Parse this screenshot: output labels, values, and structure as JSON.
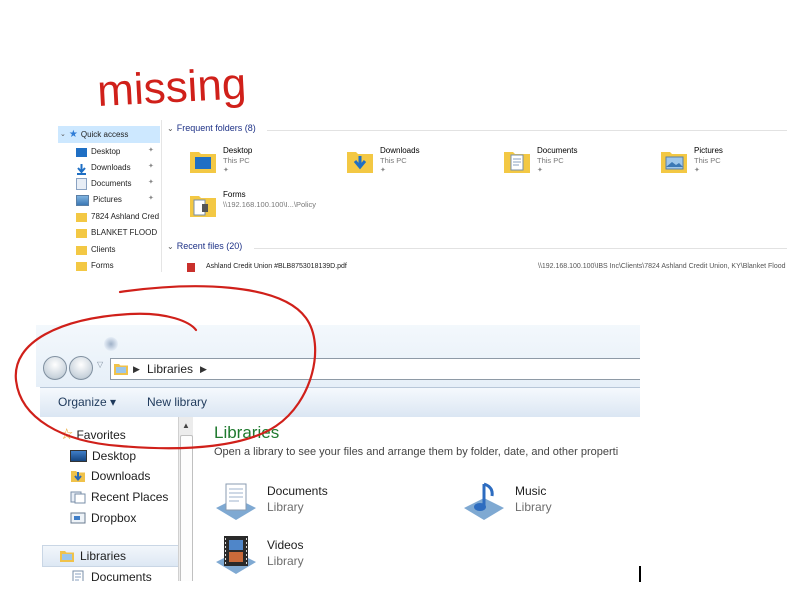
{
  "annotation": {
    "handwritten_text": "missing",
    "ink_color": "#d0201a"
  },
  "win10": {
    "nav": {
      "quick_access": "Quick access",
      "items": [
        {
          "label": "Desktop",
          "icon": "desktop-icon",
          "pinned": true
        },
        {
          "label": "Downloads",
          "icon": "downloads-icon",
          "pinned": true
        },
        {
          "label": "Documents",
          "icon": "documents-icon",
          "pinned": true
        },
        {
          "label": "Pictures",
          "icon": "pictures-icon",
          "pinned": true
        },
        {
          "label": "7824 Ashland Cred",
          "icon": "folder-icon",
          "pinned": false
        },
        {
          "label": "BLANKET FLOOD",
          "icon": "folder-icon",
          "pinned": false
        },
        {
          "label": "Clients",
          "icon": "folder-icon",
          "pinned": false
        },
        {
          "label": "Forms",
          "icon": "folder-icon",
          "pinned": false
        }
      ]
    },
    "frequent_header": "Frequent folders (8)",
    "frequent": [
      {
        "name": "Desktop",
        "location": "This PC",
        "icon": "desktop-folder-icon"
      },
      {
        "name": "Downloads",
        "location": "This PC",
        "icon": "downloads-folder-icon"
      },
      {
        "name": "Documents",
        "location": "This PC",
        "icon": "documents-folder-icon"
      },
      {
        "name": "Pictures",
        "location": "This PC",
        "icon": "pictures-folder-icon"
      },
      {
        "name": "Forms",
        "location": "\\\\192.168.100.100\\I...\\Policy",
        "icon": "network-folder-icon"
      }
    ],
    "recent_header": "Recent files (20)",
    "recent": [
      {
        "name": "Ashland Credit Union #BLB8753018139D.pdf",
        "path": "\\\\192.168.100.100\\IBS Inc\\Clients\\7824 Ashland Credit Union, KY\\Blanket Flood"
      }
    ],
    "pin_glyph": "✦"
  },
  "win7": {
    "breadcrumb": [
      "Libraries"
    ],
    "toolbar": {
      "organize": "Organize ▾",
      "new_library": "New library"
    },
    "nav": {
      "favorites": "Favorites",
      "favorites_items": [
        "Desktop",
        "Downloads",
        "Recent Places",
        "Dropbox"
      ],
      "libraries": "Libraries",
      "libraries_items": [
        "Documents"
      ]
    },
    "main": {
      "title": "Libraries",
      "description": "Open a library to see your files and arrange them by folder, date, and other properti",
      "libraries": [
        {
          "name": "Documents",
          "type": "Library",
          "icon": "documents-library-icon"
        },
        {
          "name": "Music",
          "type": "Library",
          "icon": "music-library-icon"
        },
        {
          "name": "Videos",
          "type": "Library",
          "icon": "videos-library-icon"
        }
      ]
    }
  }
}
